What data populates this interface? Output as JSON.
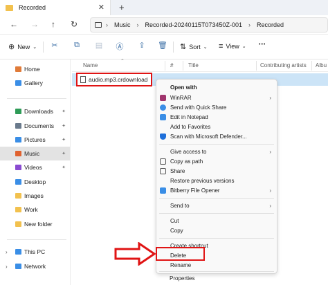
{
  "window": {
    "tab_title": "Recorded",
    "close_glyph": "✕",
    "new_tab_glyph": "+"
  },
  "address": {
    "crumbs": [
      "Music",
      "Recorded-20240115T073450Z-001",
      "Recorded"
    ],
    "separator": "›"
  },
  "toolbar": {
    "new_label": "New",
    "sort_label": "Sort",
    "view_label": "View",
    "more_glyph": "•••"
  },
  "sidebar": {
    "items": [
      {
        "label": "Home",
        "icon": "home-icon",
        "color": "#e07b39"
      },
      {
        "label": "Gallery",
        "icon": "gallery-icon",
        "color": "#3a8ee6"
      },
      {
        "label": "Downloads",
        "icon": "download-icon",
        "color": "#2e9b57"
      },
      {
        "label": "Documents",
        "icon": "document-icon",
        "color": "#6a7a8c"
      },
      {
        "label": "Pictures",
        "icon": "pictures-icon",
        "color": "#3a8ee6"
      },
      {
        "label": "Music",
        "icon": "music-icon",
        "color": "#e0622f"
      },
      {
        "label": "Videos",
        "icon": "videos-icon",
        "color": "#8a4bd1"
      },
      {
        "label": "Desktop",
        "icon": "desktop-folder-icon",
        "color": "#3a8ee6"
      },
      {
        "label": "Images",
        "icon": "folder-icon",
        "color": "#f2c14e"
      },
      {
        "label": "Work",
        "icon": "folder-icon",
        "color": "#f2c14e"
      },
      {
        "label": "New folder",
        "icon": "folder-icon",
        "color": "#f2c14e"
      },
      {
        "label": "This PC",
        "icon": "this-pc-icon",
        "color": "#3a8ee6"
      },
      {
        "label": "Network",
        "icon": "network-icon",
        "color": "#3a8ee6"
      }
    ],
    "pin_glyph": "📌"
  },
  "columns": {
    "name": "Name",
    "number": "#",
    "title": "Title",
    "contributing_artists": "Contributing artists",
    "album": "Albu"
  },
  "file": {
    "name": "audio.mp3.crdownload"
  },
  "context_menu": {
    "items": [
      {
        "label": "Open with",
        "bold": true
      },
      {
        "label": "WinRAR",
        "arrow": true,
        "icon_color": "#a0356d"
      },
      {
        "label": "Send with Quick Share",
        "icon_color": "#3a8ee6"
      },
      {
        "label": "Edit in Notepad",
        "icon_color": "#3a8ee6"
      },
      {
        "label": "Add to Favorites"
      },
      {
        "label": "Scan with Microsoft Defender...",
        "icon_color": "#1e6fd9"
      },
      {
        "label": "Give access to",
        "arrow": true
      },
      {
        "label": "Copy as path"
      },
      {
        "label": "Share"
      },
      {
        "label": "Restore previous versions"
      },
      {
        "label": "Bitberry File Opener",
        "arrow": true,
        "icon_color": "#3a8ee6"
      },
      {
        "label": "Send to",
        "arrow": true
      },
      {
        "label": "Cut"
      },
      {
        "label": "Copy"
      },
      {
        "label": "Create shortcut"
      },
      {
        "label": "Delete"
      },
      {
        "label": "Rename"
      },
      {
        "label": "Properties"
      }
    ],
    "arrow_glyph": "›"
  },
  "colors": {
    "highlight_red": "#e01414",
    "selection_blue": "#cce4f7"
  }
}
